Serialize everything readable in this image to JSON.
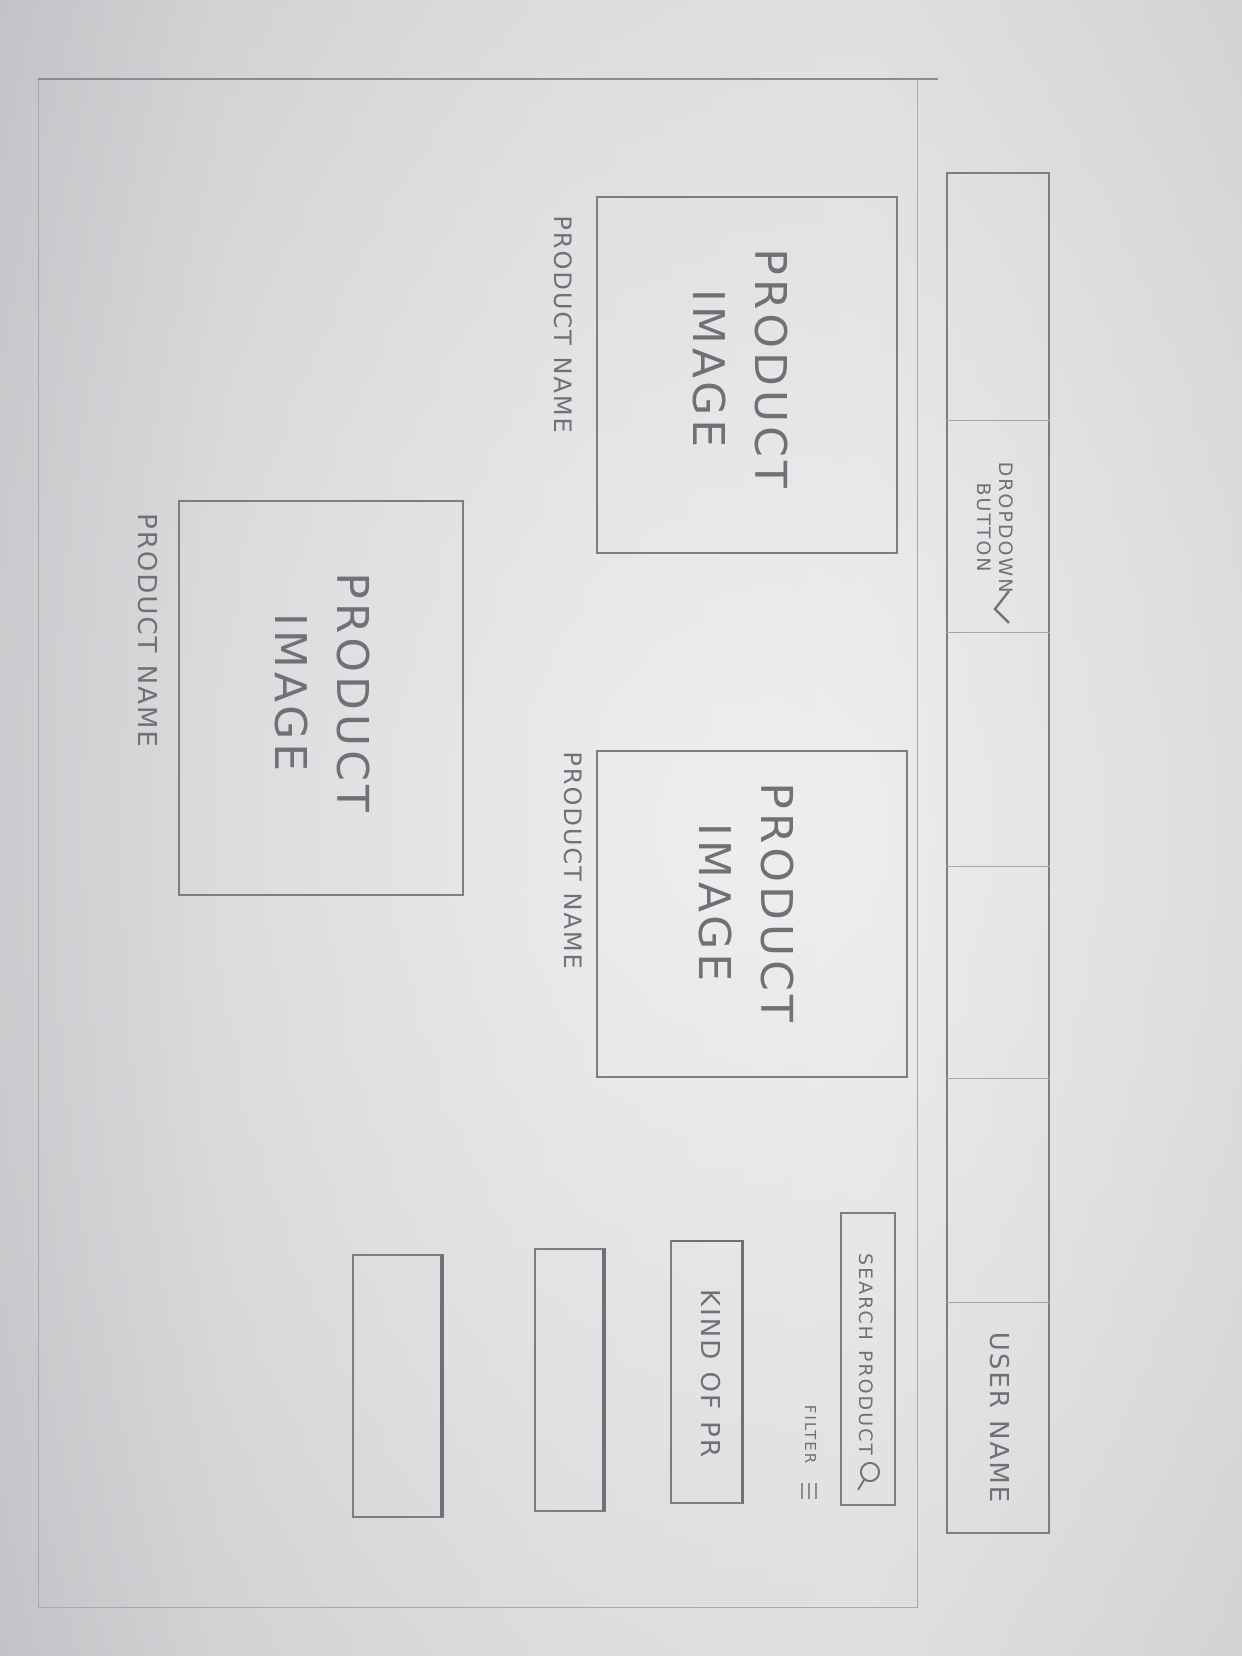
{
  "header": {
    "dropdown_label_line1": "DROPDOWN",
    "dropdown_label_line2": "BUTTON",
    "user_name": "USER NAME"
  },
  "sidebar": {
    "search_placeholder": "SEARCH PRODUCT",
    "filter_label": "FILTER",
    "kind_label": "KIND OF PR"
  },
  "products": [
    {
      "image_line1": "PRODUCT",
      "image_line2": "IMAGE",
      "name": "PRODUCT NAME"
    },
    {
      "image_line1": "PRODUCT",
      "image_line2": "IMAGE",
      "name": "PRODUCT NAME"
    },
    {
      "image_line1": "PRODUCT",
      "image_line2": "IMAGE",
      "name": "PRODUCT NAME"
    }
  ],
  "icons": {
    "chevron": "chevron-down-icon",
    "search": "search-icon",
    "filter": "hamburger-icon"
  }
}
